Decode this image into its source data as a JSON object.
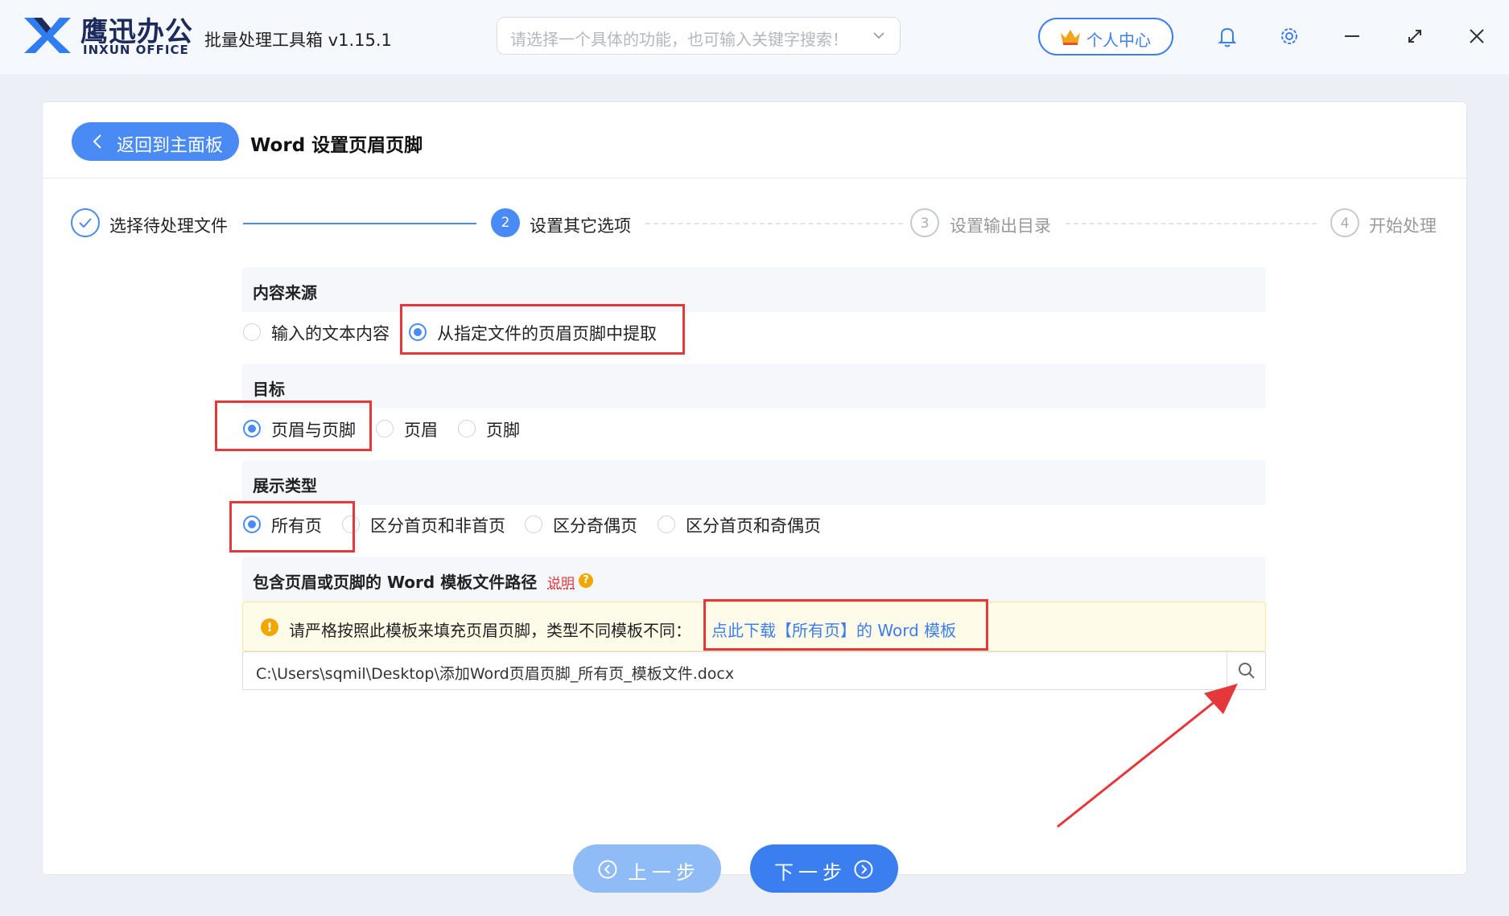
{
  "app": {
    "brand_cn": "鹰迅办公",
    "brand_en": "INXUN OFFICE",
    "title": "批量处理工具箱 v1.15.1",
    "search_placeholder": "请选择一个具体的功能，也可输入关键字搜索！",
    "user_center": "个人中心"
  },
  "page": {
    "back_label": "返回到主面板",
    "title": "Word 设置页眉页脚"
  },
  "steps": [
    {
      "num": "",
      "label": "选择待处理文件",
      "state": "done"
    },
    {
      "num": "2",
      "label": "设置其它选项",
      "state": "active"
    },
    {
      "num": "3",
      "label": "设置输出目录",
      "state": "todo"
    },
    {
      "num": "4",
      "label": "开始处理",
      "state": "todo"
    }
  ],
  "content_source": {
    "title": "内容来源",
    "options": [
      "输入的文本内容",
      "从指定文件的页眉页脚中提取"
    ],
    "selected": 1
  },
  "target": {
    "title": "目标",
    "options": [
      "页眉与页脚",
      "页眉",
      "页脚"
    ],
    "selected": 0
  },
  "display_type": {
    "title": "展示类型",
    "options": [
      "所有页",
      "区分首页和非首页",
      "区分奇偶页",
      "区分首页和奇偶页"
    ],
    "selected": 0
  },
  "template": {
    "title": "包含页眉或页脚的 Word 模板文件路径",
    "help_link": "说明",
    "notice": "请严格按照此模板来填充页眉页脚，类型不同模板不同：",
    "download_link": "点此下载【所有页】的 Word 模板",
    "path_value": "C:\\Users\\sqmil\\Desktop\\添加Word页眉页脚_所有页_模板文件.docx"
  },
  "nav": {
    "prev": "上一步",
    "next": "下一步"
  },
  "colors": {
    "accent": "#4a8af4",
    "highlight": "#e5383b",
    "warning": "#f0a800"
  }
}
